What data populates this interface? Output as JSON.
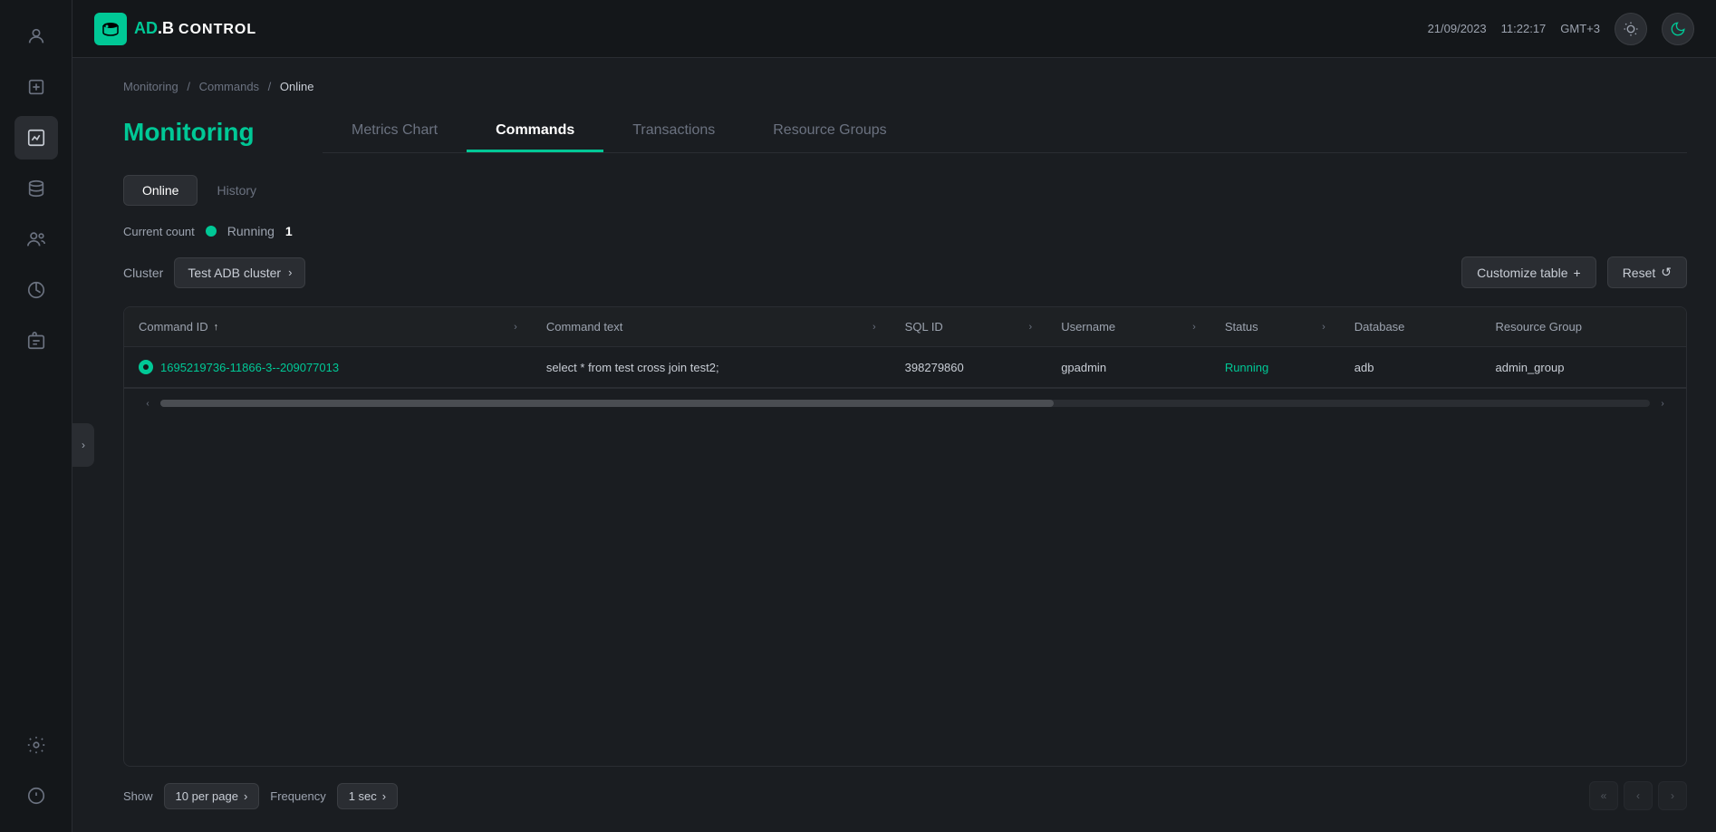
{
  "app": {
    "logo_text_ad": "AD",
    "logo_text_b": ".B",
    "logo_text_control": "CONTROL",
    "datetime": "21/09/2023",
    "time": "11:22:17",
    "timezone": "GMT+3"
  },
  "sidebar": {
    "items": [
      {
        "id": "user",
        "icon": "👤"
      },
      {
        "id": "export",
        "icon": "📤"
      },
      {
        "id": "chart",
        "icon": "📊"
      },
      {
        "id": "database",
        "icon": "🗄️"
      },
      {
        "id": "users",
        "icon": "👥"
      },
      {
        "id": "pie",
        "icon": "🥧"
      },
      {
        "id": "briefcase",
        "icon": "💼"
      },
      {
        "id": "settings",
        "icon": "⚙️"
      },
      {
        "id": "info",
        "icon": "ℹ️"
      }
    ]
  },
  "breadcrumb": {
    "items": [
      "Monitoring",
      "Commands",
      "Online"
    ],
    "separator": "/"
  },
  "page": {
    "title": "Monitoring",
    "tabs": [
      {
        "id": "metrics",
        "label": "Metrics Chart"
      },
      {
        "id": "commands",
        "label": "Commands"
      },
      {
        "id": "transactions",
        "label": "Transactions"
      },
      {
        "id": "resource_groups",
        "label": "Resource Groups"
      }
    ],
    "active_tab": "commands"
  },
  "sub_tabs": [
    {
      "id": "online",
      "label": "Online"
    },
    {
      "id": "history",
      "label": "History"
    }
  ],
  "active_sub_tab": "online",
  "status": {
    "label": "Current count",
    "running_label": "Running",
    "count": "1"
  },
  "toolbar": {
    "cluster_label": "Cluster",
    "cluster_value": "Test ADB cluster",
    "customize_label": "Customize table",
    "reset_label": "Reset"
  },
  "table": {
    "columns": [
      {
        "id": "command_id",
        "label": "Command ID",
        "sortable": true,
        "expandable": true
      },
      {
        "id": "command_text",
        "label": "Command text",
        "sortable": false,
        "expandable": true
      },
      {
        "id": "sql_id",
        "label": "SQL ID",
        "sortable": false,
        "expandable": true
      },
      {
        "id": "username",
        "label": "Username",
        "sortable": false,
        "expandable": true
      },
      {
        "id": "status",
        "label": "Status",
        "sortable": false,
        "expandable": true
      },
      {
        "id": "database",
        "label": "Database",
        "sortable": false,
        "expandable": false
      },
      {
        "id": "resource_group",
        "label": "Resource Group",
        "sortable": false,
        "expandable": false
      }
    ],
    "rows": [
      {
        "command_id": "1695219736-11866-3--209077013",
        "command_text": "select * from test cross join test2;",
        "sql_id": "398279860",
        "username": "gpadmin",
        "status": "Running",
        "database": "adb",
        "resource_group": "admin_group"
      }
    ]
  },
  "footer": {
    "show_label": "Show",
    "per_page_value": "10 per page",
    "frequency_label": "Frequency",
    "frequency_value": "1 sec"
  }
}
